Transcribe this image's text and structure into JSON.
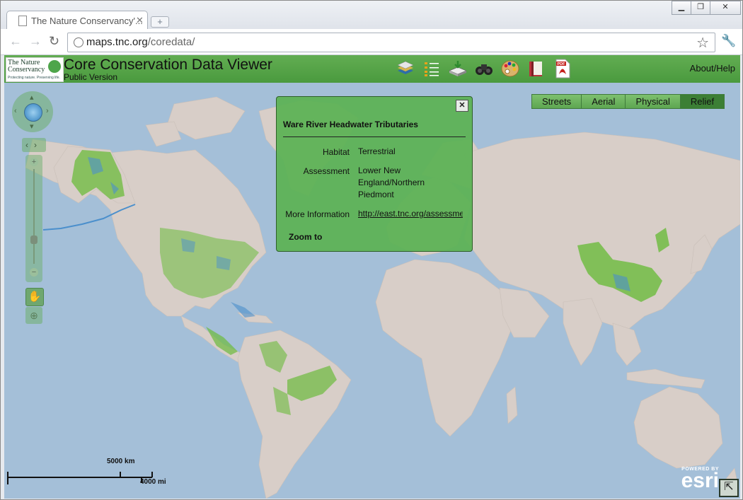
{
  "browser": {
    "tab_title": "The Nature Conservancy'...",
    "tab_close": "✕",
    "url_host": "maps.tnc.org",
    "url_path": "/coredata/"
  },
  "header": {
    "logo_line": "The Nature Conservancy",
    "logo_tagline": "Protecting nature. Preserving life.",
    "title": "Core Conservation Data Viewer",
    "subtitle": "Public Version",
    "about": "About/Help",
    "tools": [
      "layers-icon",
      "legend-icon",
      "add-data-icon",
      "binoculars-icon",
      "palette-icon",
      "book-icon",
      "pdf-icon"
    ]
  },
  "basemaps": {
    "streets": "Streets",
    "aerial": "Aerial",
    "physical": "Physical",
    "relief": "Relief",
    "active": "Relief"
  },
  "popup": {
    "title": "Ware River Headwater Tributaries",
    "close": "✕",
    "habitat_label": "Habitat",
    "habitat_value": "Terrestrial",
    "assessment_label": "Assessment",
    "assessment_value": "Lower New England/Northern Piedmont",
    "info_label": "More Information",
    "info_value": "http://east.tnc.org/assessment",
    "zoom_to": "Zoom to"
  },
  "scalebar": {
    "metric": "5000 km",
    "imperial": "4000 mi"
  },
  "esri": {
    "powered_by": "POWERED BY",
    "wordmark": "esri"
  },
  "colors": {
    "app_green": "#55a247",
    "ocean": "#a4bfd8",
    "land": "#d8cec8",
    "habitat_green": "#6cbb3c"
  }
}
